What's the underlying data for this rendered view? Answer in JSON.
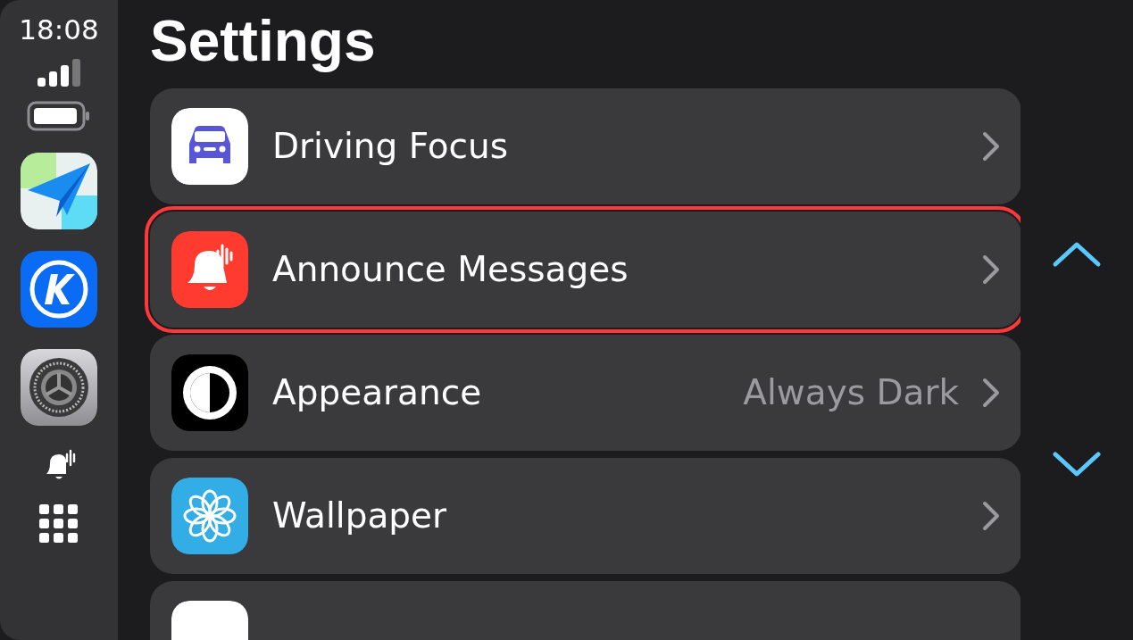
{
  "status": {
    "time": "18:08"
  },
  "dock": [
    {
      "kind": "maps"
    },
    {
      "kind": "kapp"
    },
    {
      "kind": "settings"
    },
    {
      "kind": "announce"
    },
    {
      "kind": "grid"
    }
  ],
  "title": "Settings",
  "rows": [
    {
      "kind": "driving",
      "label": "Driving Focus",
      "highlighted": false
    },
    {
      "kind": "announce",
      "label": "Announce Messages",
      "highlighted": true
    },
    {
      "kind": "appearance",
      "label": "Appearance",
      "value": "Always Dark",
      "highlighted": false
    },
    {
      "kind": "wallpaper",
      "label": "Wallpaper",
      "highlighted": false
    },
    {
      "kind": "partial",
      "highlighted": false
    }
  ]
}
